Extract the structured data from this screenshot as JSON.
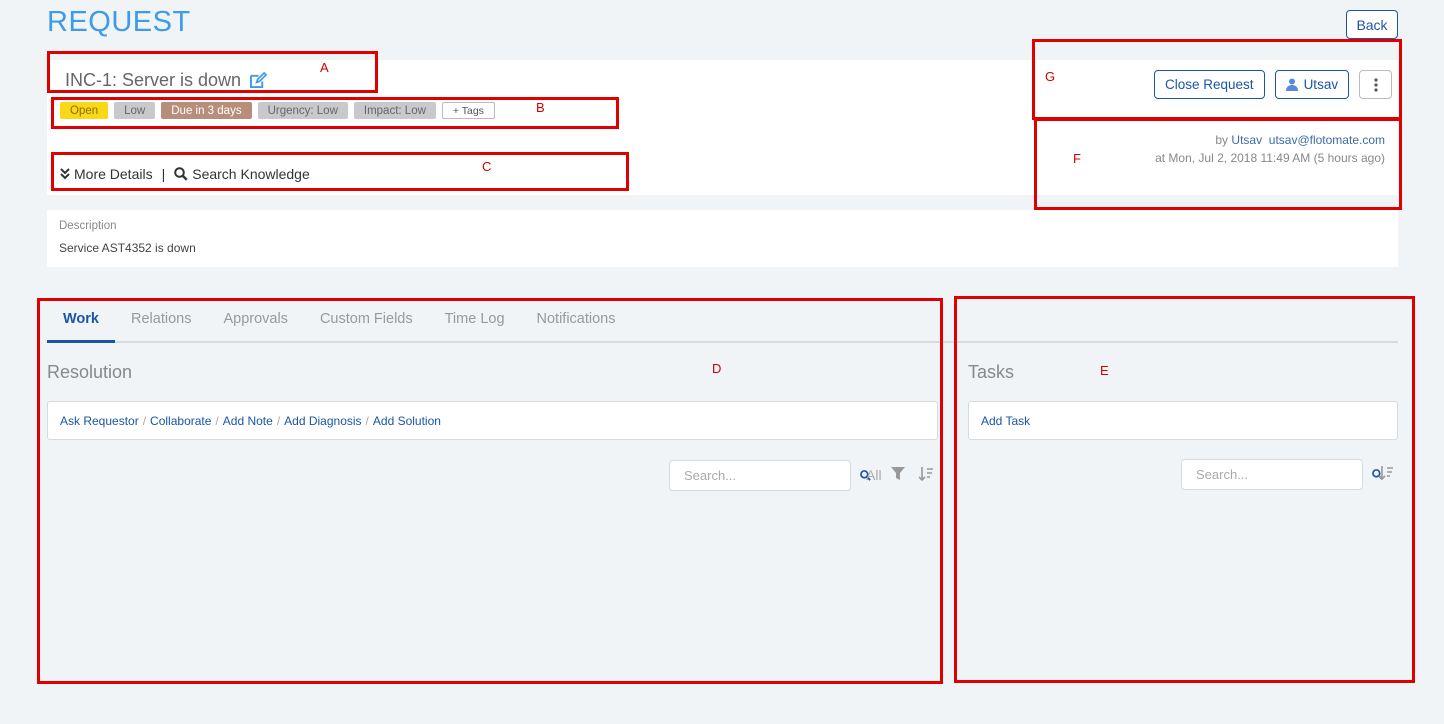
{
  "page": {
    "title": "REQUEST",
    "back_label": "Back"
  },
  "request": {
    "title": "INC-1: Server is down",
    "tags": [
      "Open",
      "Low",
      "Due in 3 days",
      "Urgency: Low",
      "Impact: Low"
    ],
    "add_tags_label": "+ Tags",
    "more_details_label": "More Details",
    "separator": "|",
    "search_knowledge_label": "Search Knowledge"
  },
  "actions": {
    "close_request_label": "Close Request",
    "assignee_label": "Utsav"
  },
  "meta": {
    "by_prefix": "by",
    "author": "Utsav",
    "email": "utsav@flotomate.com",
    "created_at": "at Mon, Jul 2, 2018 11:49 AM (5 hours ago)"
  },
  "description": {
    "label": "Description",
    "text": "Service AST4352 is down"
  },
  "tabs": [
    "Work",
    "Relations",
    "Approvals",
    "Custom Fields",
    "Time Log",
    "Notifications"
  ],
  "resolution": {
    "title": "Resolution",
    "actions": [
      "Ask Requestor",
      "Collaborate",
      "Add Note",
      "Add Diagnosis",
      "Add Solution"
    ],
    "action_separator": "/",
    "search_placeholder": "Search...",
    "filter_label": "All"
  },
  "tasks": {
    "title": "Tasks",
    "add_task_label": "Add Task",
    "search_placeholder": "Search..."
  },
  "annotations": [
    "A",
    "B",
    "C",
    "D",
    "E",
    "F",
    "G"
  ],
  "colors": {
    "accent": "#1a56a6",
    "title_blue": "#3d9be9",
    "annotation_red": "#e00000"
  },
  "icons": [
    "edit-icon",
    "chevron-double-down-icon",
    "search-icon",
    "user-icon",
    "kebab-icon",
    "filter-icon",
    "sort-icon"
  ]
}
